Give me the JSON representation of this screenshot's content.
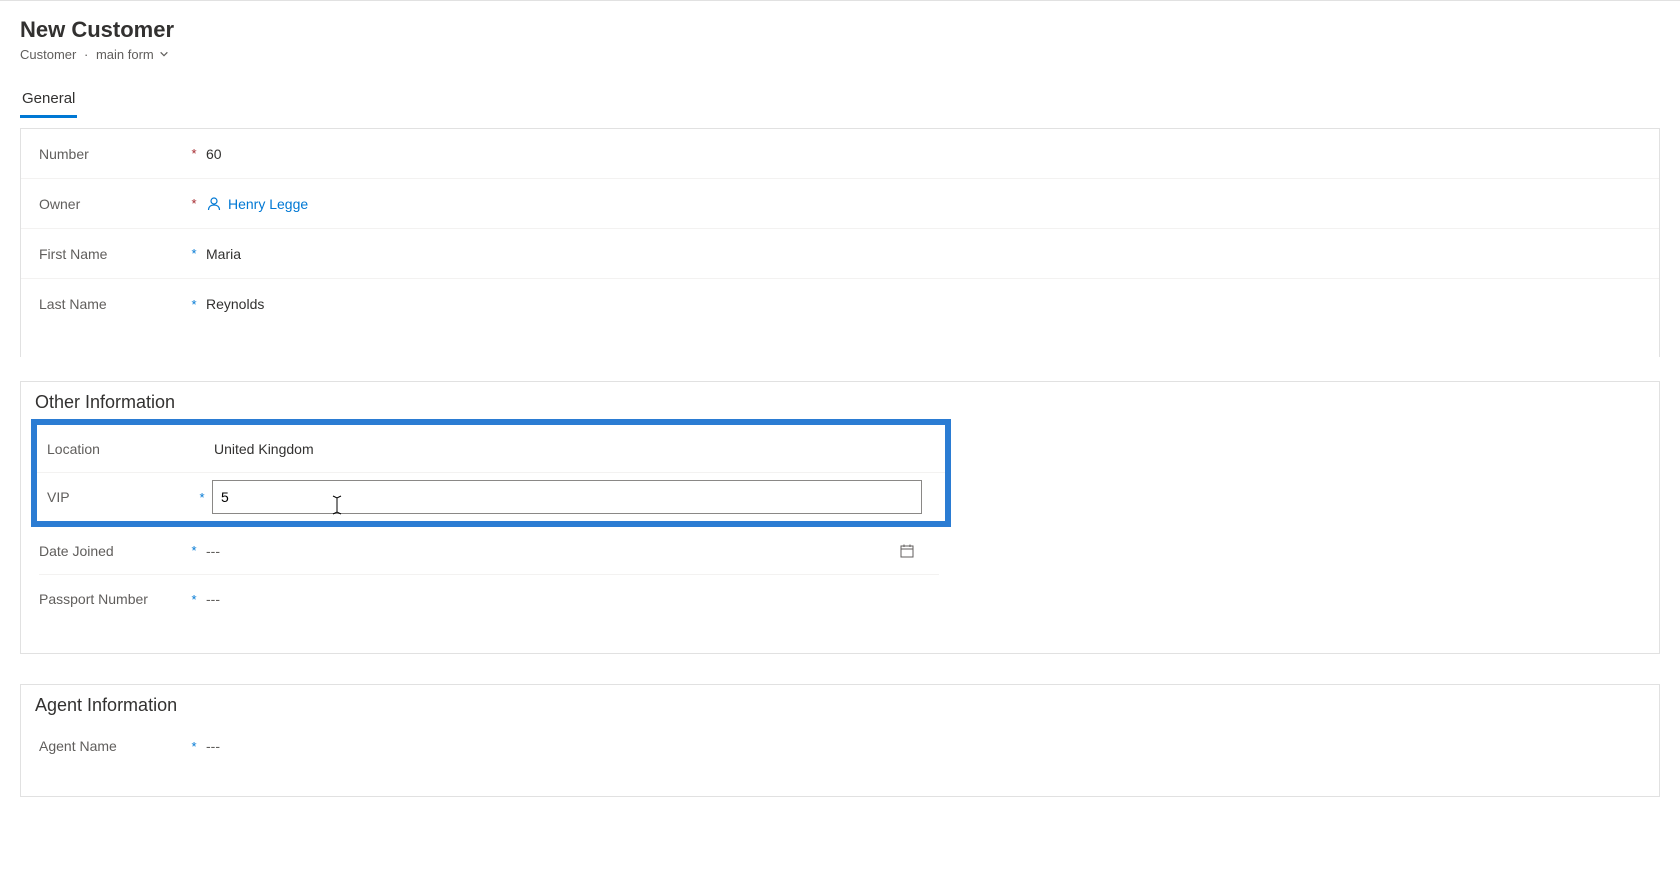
{
  "header": {
    "title": "New Customer",
    "entity": "Customer",
    "formName": "main form"
  },
  "tabs": [
    {
      "label": "General",
      "active": true
    }
  ],
  "generalSection": {
    "fields": {
      "number": {
        "label": "Number",
        "value": "60"
      },
      "owner": {
        "label": "Owner",
        "value": "Henry Legge"
      },
      "firstName": {
        "label": "First Name",
        "value": "Maria"
      },
      "lastName": {
        "label": "Last Name",
        "value": "Reynolds"
      }
    }
  },
  "otherSection": {
    "title": "Other Information",
    "fields": {
      "location": {
        "label": "Location",
        "value": "United Kingdom"
      },
      "vip": {
        "label": "VIP",
        "value": "5"
      },
      "dateJoined": {
        "label": "Date Joined",
        "value": "---"
      },
      "passportNumber": {
        "label": "Passport Number",
        "value": "---"
      }
    }
  },
  "agentSection": {
    "title": "Agent Information",
    "fields": {
      "agentName": {
        "label": "Agent Name",
        "value": "---"
      }
    }
  }
}
